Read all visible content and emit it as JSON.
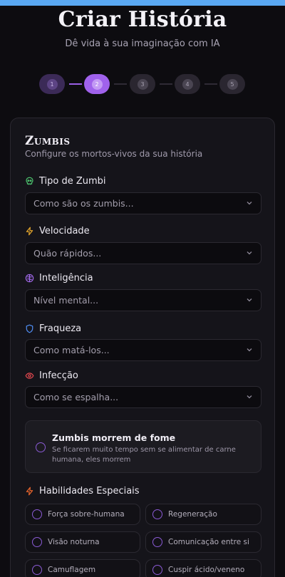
{
  "page": {
    "title": "Criar História",
    "subtitle": "Dê vida à sua imaginação com IA"
  },
  "stepper": {
    "steps": [
      "1",
      "2",
      "3",
      "4",
      "5"
    ],
    "current": 2
  },
  "card": {
    "title": "Zumbis",
    "subtitle": "Configure os mortos-vivos da sua história"
  },
  "fields": [
    {
      "label": "Tipo de Zumbi",
      "icon": "skull-icon",
      "color": "#4cc16d",
      "placeholder": "Como são os zumbis..."
    },
    {
      "label": "Velocidade",
      "icon": "lightning-icon",
      "color": "#e3a52b",
      "placeholder": "Quão rápidos..."
    },
    {
      "label": "Inteligência",
      "icon": "brain-icon",
      "color": "#a56bf0",
      "placeholder": "Nível mental..."
    },
    {
      "label": "Fraqueza",
      "icon": "shield-icon",
      "color": "#4f8df2",
      "placeholder": "Como matá-los..."
    },
    {
      "label": "Infecção",
      "icon": "eye-icon",
      "color": "#e2484f",
      "placeholder": "Como se espalha..."
    }
  ],
  "starve_option": {
    "title": "Zumbis morrem de fome",
    "description": "Se ficarem muito tempo sem se alimentar de carne humana, eles morrem"
  },
  "abilities": {
    "label": "Habilidades Especiais",
    "icon": "lightning-icon",
    "color": "#e8642c",
    "items": [
      "Força sobre-humana",
      "Regeneração",
      "Visão noturna",
      "Comunicação entre si",
      "Camuflagem",
      "Cuspir ácido/veneno"
    ]
  },
  "colors": {
    "accent": "#a062ec",
    "background": "#0d0c10",
    "card": "#15141a"
  }
}
